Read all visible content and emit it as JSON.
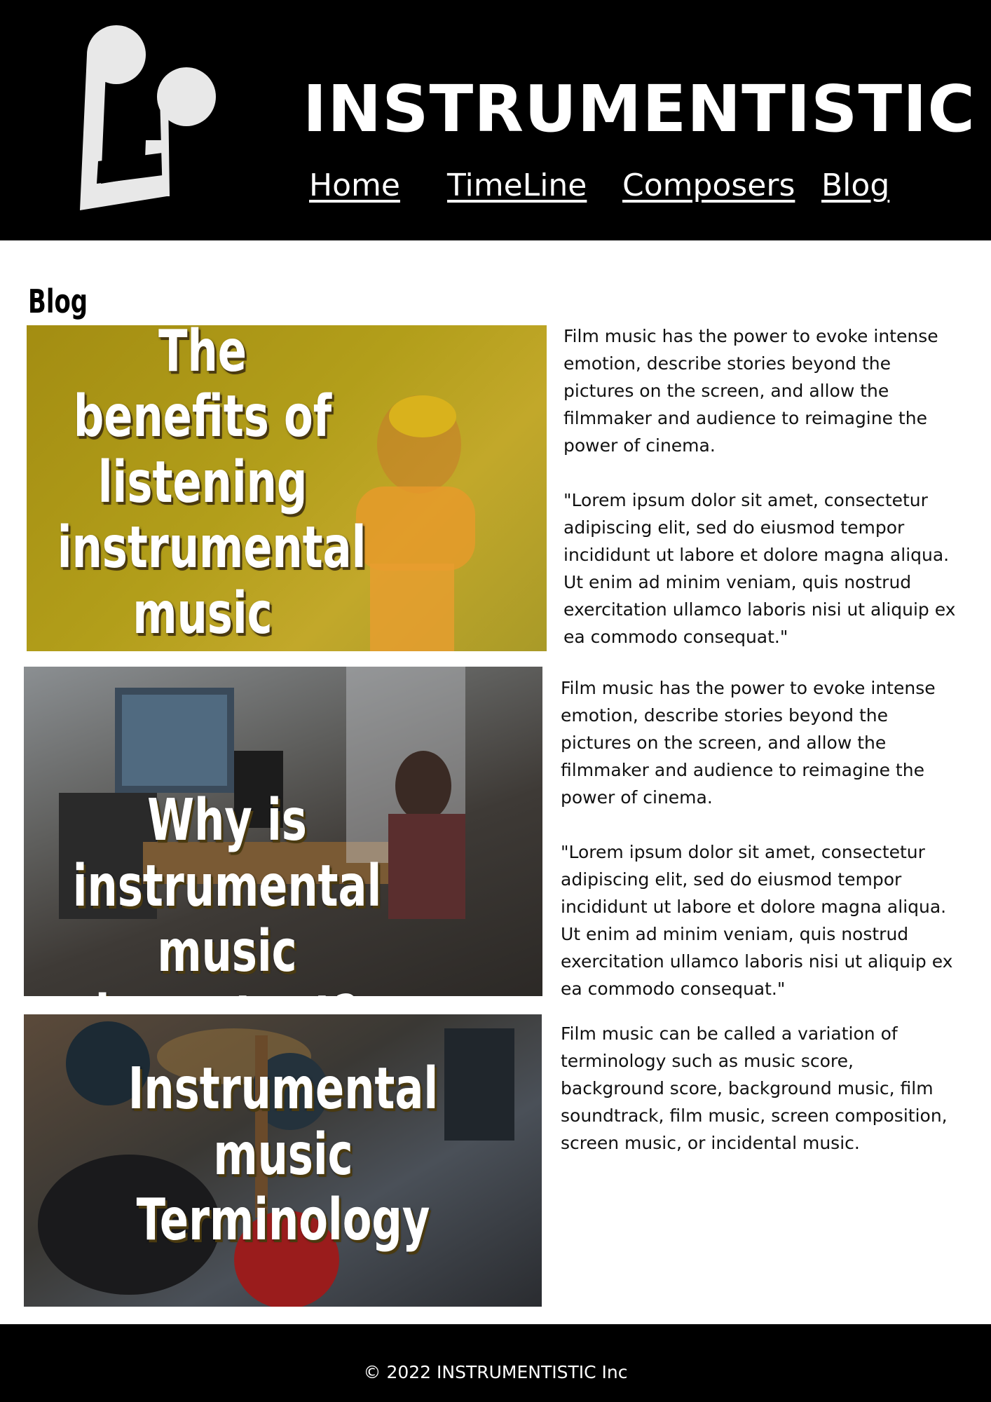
{
  "header": {
    "site_title": "INSTRUMENTISTIC",
    "logo_icon": "music-note-icon",
    "nav": [
      {
        "label": "Home"
      },
      {
        "label": "TimeLine"
      },
      {
        "label": "Composers"
      },
      {
        "label": "Blog"
      }
    ]
  },
  "main": {
    "heading": "Blog",
    "posts": [
      {
        "image_title": "The benefits of listening instrumental music",
        "paragraph_1": " Film music has the power to evoke intense emotion, describe stories beyond the pictures on the screen, and allow the filmmaker and audience to reimagine the power of cinema.",
        "paragraph_2": "\"Lorem ipsum dolor sit amet, consectetur adipiscing elit, sed do eiusmod tempor incididunt ut labore et dolore magna aliqua. Ut enim ad minim veniam, quis nostrud exercitation ullamco laboris nisi ut aliquip ex ea commodo consequat.\""
      },
      {
        "image_title": "Why is instrumental music important?",
        "paragraph_1": " Film music has the power to evoke intense emotion, describe stories beyond the pictures on the screen, and allow the filmmaker and audience to reimagine the power of cinema.",
        "paragraph_2": "\"Lorem ipsum dolor sit amet, consectetur adipiscing elit, sed do eiusmod tempor incididunt ut labore et dolore magna aliqua. Ut enim ad minim veniam, quis nostrud exercitation ullamco laboris nisi ut aliquip ex ea commodo consequat.\""
      },
      {
        "image_title": "Instrumental music Terminology",
        "paragraph_1": " Film music can be called a variation of terminology such as music score, background score, background music, film soundtrack, film music, screen composition, screen music, or incidental music."
      }
    ]
  },
  "footer": {
    "copyright": "© 2022 INSTRUMENTISTIC Inc"
  },
  "colors": {
    "header_bg": "#000000",
    "footer_bg": "#000000",
    "text_on_dark": "#ffffff",
    "page_bg": "#ffffff"
  }
}
